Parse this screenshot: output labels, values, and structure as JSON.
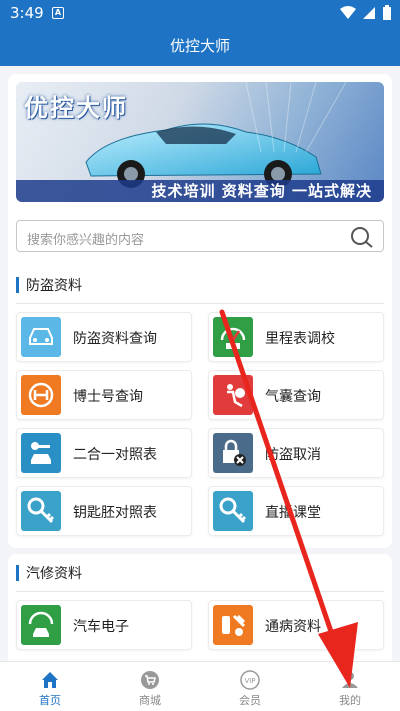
{
  "status": {
    "time": "3:49",
    "notif_letter": "A"
  },
  "header": {
    "title": "优控大师"
  },
  "banner": {
    "title": "优控大师",
    "slogan": "技术培训  资料查询  一站式解决"
  },
  "search": {
    "placeholder": "搜索你感兴趣的内容"
  },
  "sections": [
    {
      "title": "防盗资料",
      "items": [
        {
          "label": "防盗资料查询",
          "icon": "car-icon",
          "color": "#5bb8e6"
        },
        {
          "label": "里程表调校",
          "icon": "odometer-icon",
          "color": "#2f9e44"
        },
        {
          "label": "博士号查询",
          "icon": "bosch-icon",
          "color": "#f07a22"
        },
        {
          "label": "气囊查询",
          "icon": "airbag-icon",
          "color": "#e23b3b"
        },
        {
          "label": "二合一对照表",
          "icon": "key-car-icon",
          "color": "#2a8fc4"
        },
        {
          "label": "防盗取消",
          "icon": "lock-cancel-icon",
          "color": "#4a6b8a"
        },
        {
          "label": "钥匙胚对照表",
          "icon": "key-icon",
          "color": "#3aa2c8"
        },
        {
          "label": "直播课堂",
          "icon": "live-key-icon",
          "color": "#3aa2c8"
        }
      ]
    },
    {
      "title": "汽修资料",
      "items": [
        {
          "label": "汽车电子",
          "icon": "car-electronics-icon",
          "color": "#2f9e44"
        },
        {
          "label": "通病资料",
          "icon": "tools-icon",
          "color": "#f07a22"
        }
      ]
    }
  ],
  "tabs": [
    {
      "label": "首页",
      "icon": "home-icon",
      "active": true
    },
    {
      "label": "商城",
      "icon": "cart-icon",
      "active": false
    },
    {
      "label": "会员",
      "icon": "vip-icon",
      "active": false
    },
    {
      "label": "我的",
      "icon": "user-icon",
      "active": false
    }
  ],
  "colors": {
    "primary": "#1f73c4",
    "annotation_arrow": "#e8261e"
  }
}
